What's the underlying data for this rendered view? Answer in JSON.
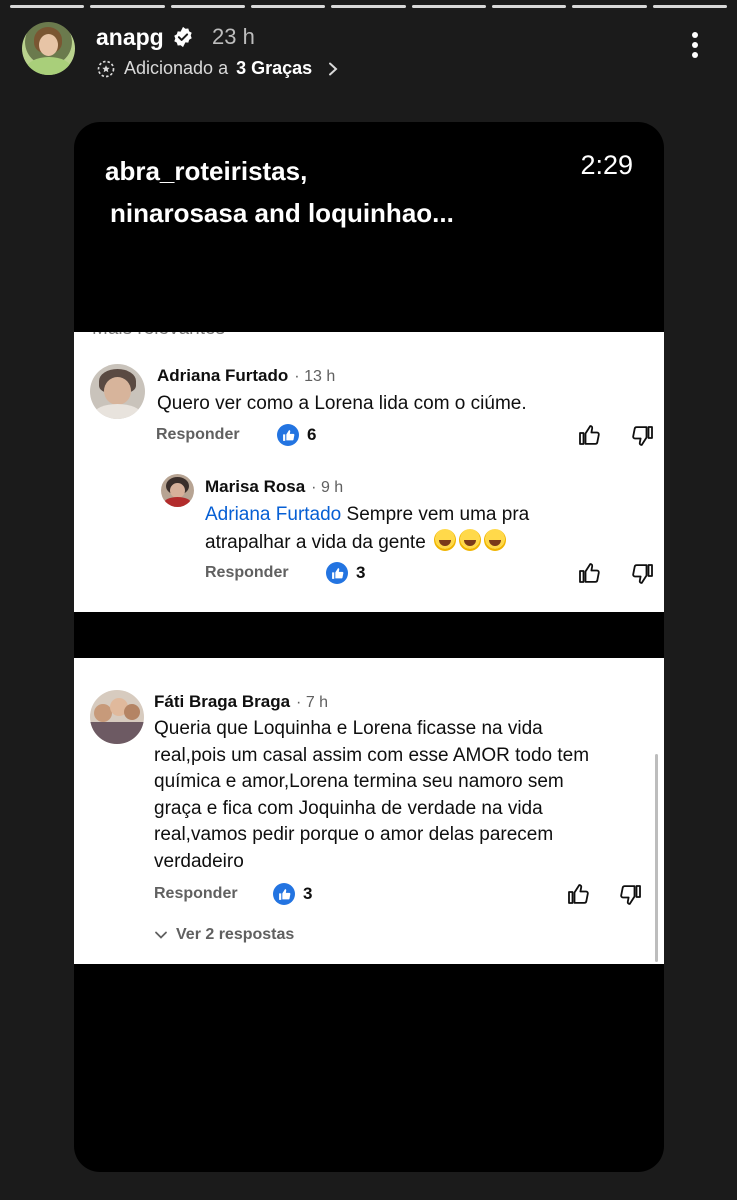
{
  "story": {
    "username": "anapg",
    "time_ago": "23 h",
    "added_prefix": "Adicionado a",
    "highlight_name": "3 Graças",
    "progress_segments": 9
  },
  "card": {
    "title_line1": "abra_roteiristas,",
    "title_line2": "ninarosasa and loquinhao...",
    "timestamp": "2:29",
    "panel1_cut_text": "Mais relevantes"
  },
  "comments": [
    {
      "author": "Adriana Furtado",
      "time": "· 13 h",
      "text": "Quero ver como a Lorena lida com o ciúme.",
      "reply_label": "Responder",
      "likes": "6"
    },
    {
      "author": "Marisa Rosa",
      "time": "· 9 h",
      "mention": "Adriana Furtado",
      "text_line1": "Sempre vem uma pra",
      "text_line2": "atrapalhar a vida da gente",
      "reply_label": "Responder",
      "likes": "3"
    },
    {
      "author": "Fáti Braga Braga",
      "time": "· 7 h",
      "text_lines": [
        "Queria que Loquinha  e Lorena ficasse  na vida",
        "real,pois um casal assim com esse AMOR todo tem",
        "química e amor,Lorena termina seu namoro sem",
        "graça  e fica com Joquinha de verdade na vida",
        "real,vamos pedir porque o amor delas parecem",
        "verdadeiro"
      ],
      "reply_label": "Responder",
      "likes": "3",
      "view_replies": "Ver 2 respostas"
    }
  ],
  "colors": {
    "accent_blue": "#065fd4",
    "like_blue": "#2374e1"
  }
}
